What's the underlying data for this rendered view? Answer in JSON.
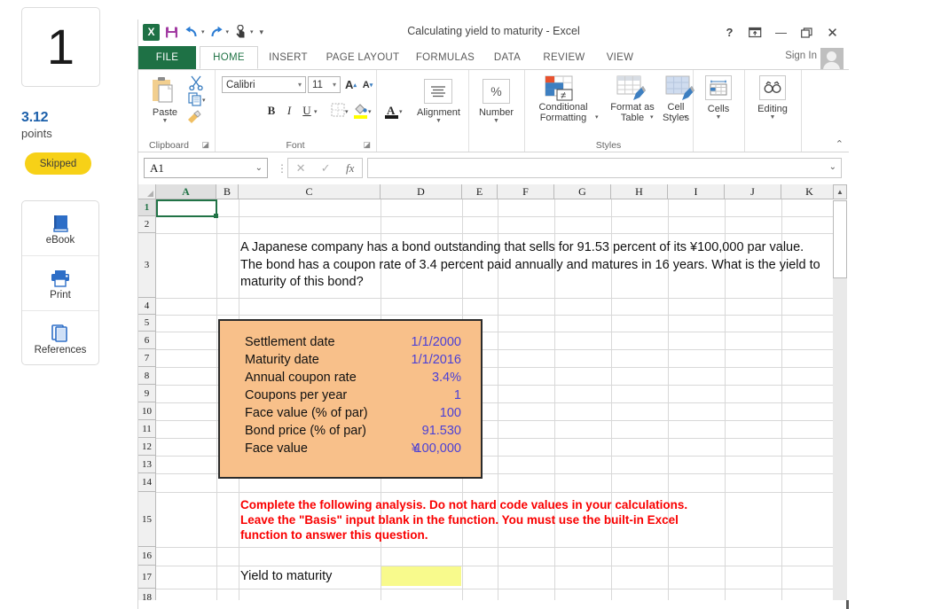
{
  "sidebar": {
    "question_number": "1",
    "points_value": "3.12",
    "points_label": "points",
    "status_badge": "Skipped",
    "tools": [
      {
        "label": "eBook",
        "icon": "book-icon"
      },
      {
        "label": "Print",
        "icon": "printer-icon"
      },
      {
        "label": "References",
        "icon": "copy-pages-icon"
      }
    ]
  },
  "excel": {
    "title": "Calculating yield to maturity - Excel",
    "quick_access": [
      {
        "name": "excel-logo",
        "glyph": "X"
      },
      {
        "name": "save-icon",
        "glyph": "὚B"
      },
      {
        "name": "undo-icon",
        "glyph": "↶"
      },
      {
        "name": "redo-icon",
        "glyph": "↷"
      },
      {
        "name": "touch-mode-icon",
        "glyph": "☝"
      },
      {
        "name": "customize-qat-icon",
        "glyph": "▾"
      }
    ],
    "window_buttons": [
      {
        "name": "help-button",
        "glyph": "?"
      },
      {
        "name": "ribbon-display-options-button",
        "glyph": "⤒"
      },
      {
        "name": "minimize-button",
        "glyph": "—"
      },
      {
        "name": "restore-button",
        "glyph": "❐"
      },
      {
        "name": "close-button",
        "glyph": "✕"
      }
    ],
    "tabs": [
      {
        "label": "FILE",
        "active": false
      },
      {
        "label": "HOME",
        "active": true
      },
      {
        "label": "INSERT",
        "active": false
      },
      {
        "label": "PAGE LAYOUT",
        "active": false
      },
      {
        "label": "FORMULAS",
        "active": false
      },
      {
        "label": "DATA",
        "active": false
      },
      {
        "label": "REVIEW",
        "active": false
      },
      {
        "label": "VIEW",
        "active": false
      }
    ],
    "sign_in": "Sign In",
    "ribbon": {
      "groups": [
        {
          "name": "clipboard",
          "label": "Clipboard"
        },
        {
          "name": "font",
          "label": "Font"
        },
        {
          "name": "alignment",
          "label": ""
        },
        {
          "name": "number",
          "label": ""
        },
        {
          "name": "styles",
          "label": "Styles"
        },
        {
          "name": "cells",
          "label": ""
        },
        {
          "name": "editing",
          "label": ""
        }
      ],
      "paste_label": "Paste",
      "font_name": "Calibri",
      "font_size": "11",
      "grow_font": "A",
      "shrink_font": "A",
      "bold": "B",
      "italic": "I",
      "underline": "U",
      "alignment_label": "Alignment",
      "number_label": "Number",
      "percent_glyph": "%",
      "conditional_formatting_label": "Conditional\nFormatting",
      "conditional_formatting_line1": "Conditional",
      "conditional_formatting_line2": "Formatting",
      "format_as_table_line1": "Format as",
      "format_as_table_line2": "Table",
      "cell_styles_line1": "Cell",
      "cell_styles_line2": "Styles",
      "cells_label": "Cells",
      "editing_label": "Editing"
    },
    "formula_bar": {
      "name_box": "A1",
      "cancel_glyph": "✕",
      "enter_glyph": "✓",
      "function_glyph": "fx",
      "formula_value": ""
    },
    "grid": {
      "columns": [
        "A",
        "B",
        "C",
        "D",
        "E",
        "F",
        "G",
        "H",
        "I",
        "J",
        "K"
      ],
      "rows": [
        "1",
        "2",
        "3",
        "4",
        "5",
        "6",
        "7",
        "8",
        "9",
        "10",
        "11",
        "12",
        "13",
        "14",
        "15",
        "16",
        "17",
        "18"
      ],
      "selected_cell": "A1"
    },
    "content": {
      "question_text": "A Japanese company has a bond outstanding that sells for 91.53 percent of its ¥100,000 par value. The bond has a coupon rate of 3.4 percent paid annually and matures in 16 years. What is the yield to maturity of this bond?",
      "input_box": {
        "rows": [
          {
            "label": "Settlement date",
            "value": "1/1/2000",
            "currency": ""
          },
          {
            "label": "Maturity date",
            "value": "1/1/2016",
            "currency": ""
          },
          {
            "label": "Annual coupon rate",
            "value": "3.4%",
            "currency": ""
          },
          {
            "label": "Coupons per year",
            "value": "1",
            "currency": ""
          },
          {
            "label": "Face value (% of par)",
            "value": "100",
            "currency": ""
          },
          {
            "label": "Bond price (% of par)",
            "value": "91.530",
            "currency": ""
          },
          {
            "label": "Face value",
            "value": "100,000",
            "currency": "¥"
          }
        ]
      },
      "instruction_line1": "Complete the following analysis. Do not hard code values in your calculations.",
      "instruction_line2": "Leave the \"Basis\" input blank in the function. You must use the built-in Excel",
      "instruction_line3": "function to answer this question.",
      "answer_label": "Yield to maturity",
      "answer_value": ""
    }
  },
  "colors": {
    "excel_green": "#1e7145",
    "tab_active_green": "#217346",
    "input_box_fill": "#f8c08a",
    "input_value_blue": "#4a3fd6",
    "instruction_red": "#f90000",
    "answer_cell_yellow": "#f8fa8c",
    "skipped_yellow": "#f7d117",
    "points_blue": "#1b5faa"
  }
}
